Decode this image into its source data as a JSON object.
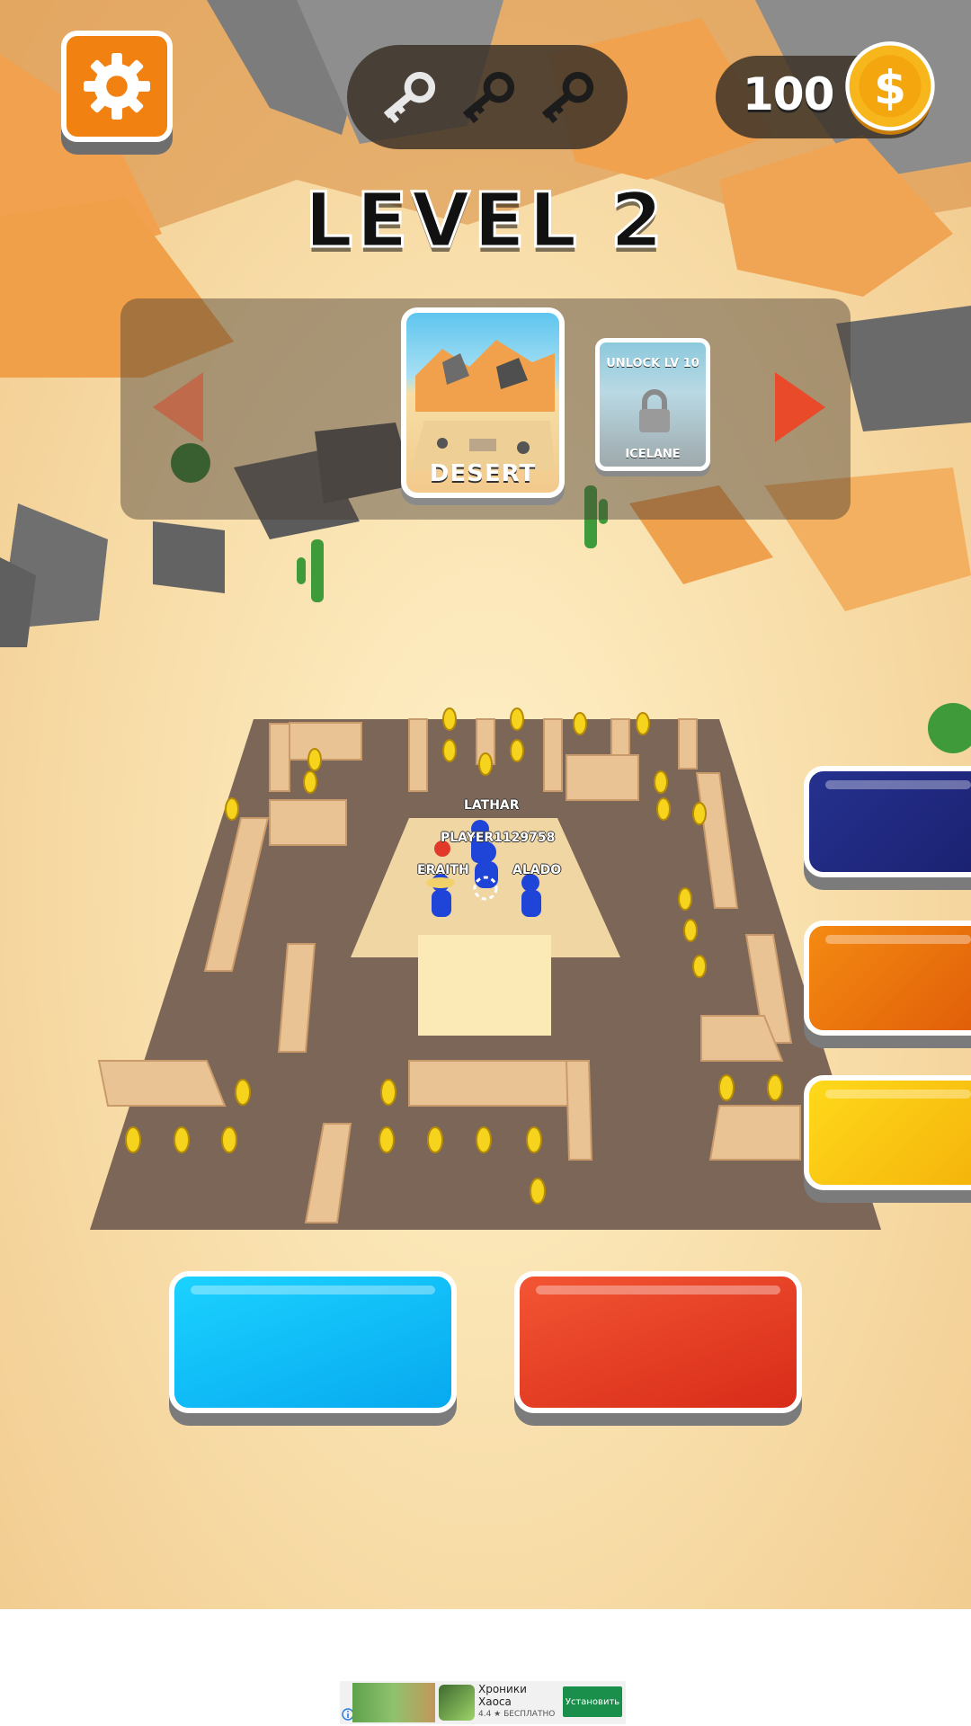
{
  "hud": {
    "coins": "100",
    "keys_collected": 1,
    "keys_total": 3
  },
  "level": {
    "title": "LEVEL 2"
  },
  "map_selector": {
    "current_map": "DESERT",
    "next_map": "ICELANE",
    "next_map_lock_text": "UNLOCK LV 10"
  },
  "players": [
    {
      "name": "LATHAR"
    },
    {
      "name": "PLAYER1129758"
    },
    {
      "name": "ERAITH"
    },
    {
      "name": "ALADO"
    }
  ],
  "colors": {
    "settings": "#f18212",
    "navy": "#1f2a80",
    "orange": "#f07a10",
    "yellow": "#fcc812",
    "blue": "#12c0fb",
    "red": "#e64227",
    "coin": "#f7b71c"
  },
  "icons": [
    "gear-icon",
    "key-icon",
    "coin-icon",
    "arrow-left-icon",
    "arrow-right-icon",
    "lock-icon"
  ],
  "ad": {
    "title": "Хроники Хаоса",
    "rating": "4.4 ★ БЕСПЛАТНО",
    "install_label": "Установить"
  }
}
